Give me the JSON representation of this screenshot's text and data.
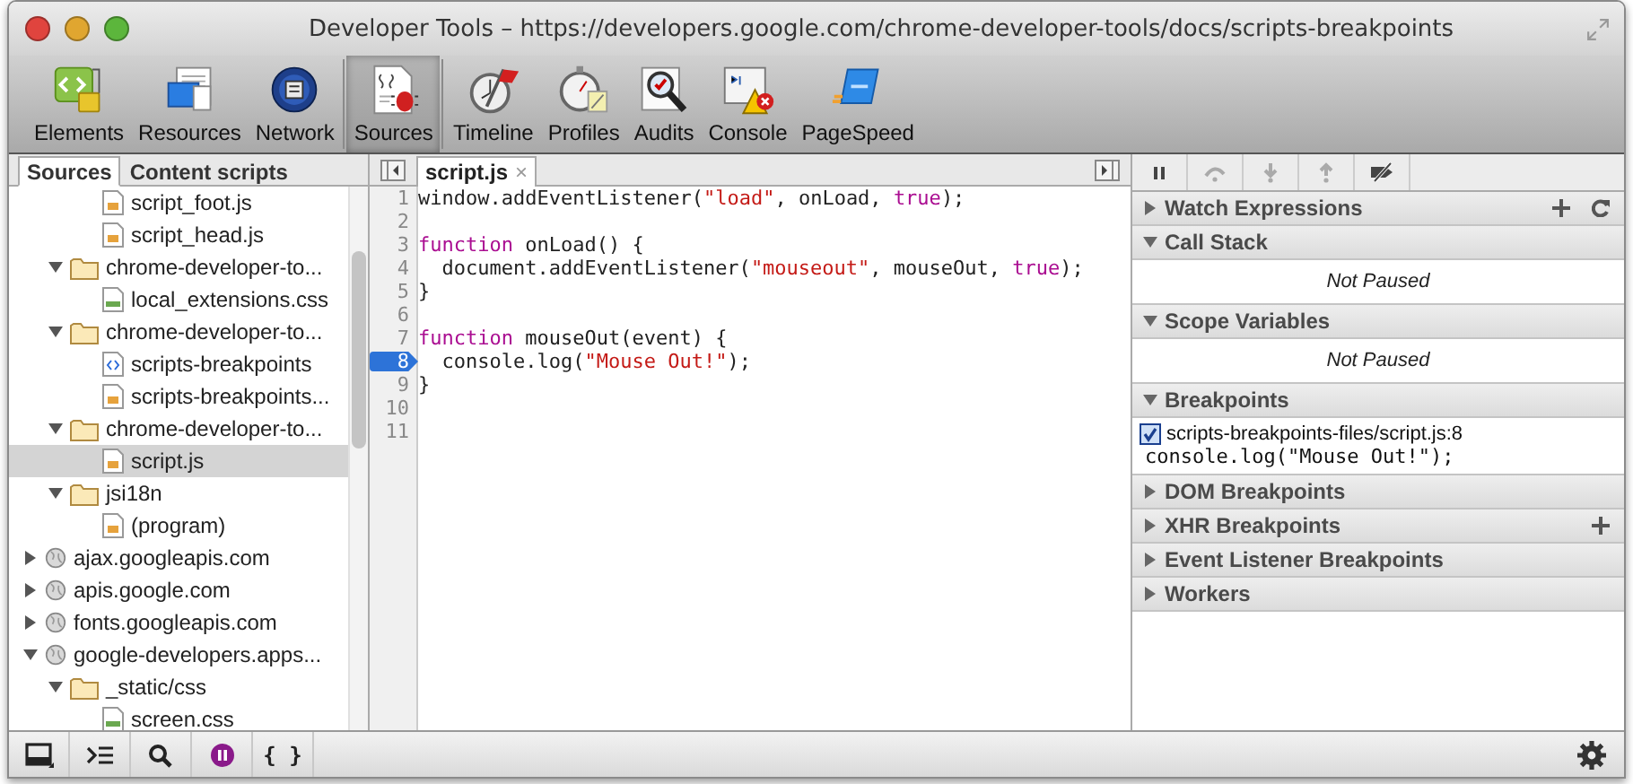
{
  "window": {
    "title": "Developer Tools – https://developers.google.com/chrome-developer-tools/docs/scripts-breakpoints"
  },
  "toolbar": [
    {
      "kind": "elements",
      "label": "Elements",
      "selected": false,
      "separator_before": false
    },
    {
      "kind": "resources",
      "label": "Resources",
      "selected": false,
      "separator_before": false
    },
    {
      "kind": "network",
      "label": "Network",
      "selected": false,
      "separator_before": false
    },
    {
      "kind": "sources",
      "label": "Sources",
      "selected": true,
      "separator_before": true
    },
    {
      "kind": "timeline",
      "label": "Timeline",
      "selected": false,
      "separator_before": true
    },
    {
      "kind": "profiles",
      "label": "Profiles",
      "selected": false,
      "separator_before": false
    },
    {
      "kind": "audits",
      "label": "Audits",
      "selected": false,
      "separator_before": false
    },
    {
      "kind": "console",
      "label": "Console",
      "selected": false,
      "separator_before": false
    },
    {
      "kind": "pagespeed",
      "label": "PageSpeed",
      "selected": false,
      "separator_before": false
    }
  ],
  "navigator": {
    "tabs": [
      {
        "label": "Sources",
        "selected": true
      },
      {
        "label": "Content scripts",
        "selected": false
      }
    ],
    "tree": [
      {
        "children": [
          {
            "children": [
              {
                "kind": "script",
                "label": "script_foot.js",
                "selected": false
              },
              {
                "kind": "script",
                "label": "script_head.js",
                "selected": false
              }
            ]
          },
          {
            "kind": "folder",
            "label": "chrome-developer-to...",
            "expanded": true,
            "children": [
              {
                "kind": "stylesheet",
                "label": "local_extensions.css",
                "selected": false
              }
            ]
          },
          {
            "kind": "folder",
            "label": "chrome-developer-to...",
            "expanded": true,
            "children": [
              {
                "kind": "document",
                "label": "scripts-breakpoints",
                "selected": false
              },
              {
                "kind": "script",
                "label": "scripts-breakpoints...",
                "selected": false
              }
            ]
          },
          {
            "kind": "folder",
            "label": "chrome-developer-to...",
            "expanded": true,
            "children": [
              {
                "kind": "script",
                "label": "script.js",
                "selected": true
              }
            ]
          },
          {
            "kind": "folder",
            "label": "jsi18n",
            "expanded": true,
            "children": [
              {
                "kind": "script",
                "label": "(program)",
                "selected": false
              }
            ]
          }
        ]
      },
      {
        "kind": "domain",
        "label": "ajax.googleapis.com",
        "expanded": false
      },
      {
        "kind": "domain",
        "label": "apis.google.com",
        "expanded": false
      },
      {
        "kind": "domain",
        "label": "fonts.googleapis.com",
        "expanded": false
      },
      {
        "kind": "domain",
        "label": "google-developers.apps...",
        "expanded": true,
        "children": [
          {
            "kind": "folder",
            "label": "_static/css",
            "expanded": true,
            "children": [
              {
                "kind": "stylesheet",
                "label": "screen.css",
                "selected": false
              }
            ]
          }
        ]
      }
    ]
  },
  "editor": {
    "tab": {
      "label": "script.js",
      "close": "×"
    },
    "lines": [
      {
        "number": "1",
        "breakpoint": false,
        "tokens": [
          {
            "kind": "plain",
            "text": "window.addEventListener("
          },
          {
            "kind": "string",
            "text": "\"load\""
          },
          {
            "kind": "plain",
            "text": ", onLoad, "
          },
          {
            "kind": "keyword",
            "text": "true"
          },
          {
            "kind": "plain",
            "text": ");"
          }
        ]
      },
      {
        "number": "2",
        "breakpoint": false
      },
      {
        "number": "3",
        "breakpoint": false,
        "tokens": [
          {
            "kind": "keyword",
            "text": "function"
          },
          {
            "kind": "plain",
            "text": " onLoad() {"
          }
        ]
      },
      {
        "number": "4",
        "breakpoint": false,
        "tokens": [
          {
            "kind": "plain",
            "text": "  document.addEventListener("
          },
          {
            "kind": "string",
            "text": "\"mouseout\""
          },
          {
            "kind": "plain",
            "text": ", mouseOut, "
          },
          {
            "kind": "keyword",
            "text": "true"
          },
          {
            "kind": "plain",
            "text": ");"
          }
        ]
      },
      {
        "number": "5",
        "breakpoint": false,
        "tokens": [
          {
            "kind": "plain",
            "text": "}"
          }
        ]
      },
      {
        "number": "6",
        "breakpoint": false
      },
      {
        "number": "7",
        "breakpoint": false,
        "tokens": [
          {
            "kind": "keyword",
            "text": "function"
          },
          {
            "kind": "plain",
            "text": " mouseOut(event) {"
          }
        ]
      },
      {
        "number": "8",
        "breakpoint": true,
        "tokens": [
          {
            "kind": "plain",
            "text": "  console.log("
          },
          {
            "kind": "string",
            "text": "\"Mouse Out!\""
          },
          {
            "kind": "plain",
            "text": ");"
          }
        ]
      },
      {
        "number": "9",
        "breakpoint": false,
        "tokens": [
          {
            "kind": "plain",
            "text": "}"
          }
        ]
      },
      {
        "number": "10",
        "breakpoint": false
      },
      {
        "number": "11",
        "breakpoint": false
      }
    ]
  },
  "debugger": {
    "buttons": [
      {
        "kind": "pause",
        "disabled": false
      },
      {
        "kind": "step-over",
        "disabled": true
      },
      {
        "kind": "step-into",
        "disabled": true
      },
      {
        "kind": "step-out",
        "disabled": true
      },
      {
        "kind": "deactivate",
        "disabled": false
      }
    ],
    "sections": [
      {
        "title": "Watch Expressions",
        "expanded": false,
        "actions": [
          {
            "kind": "add"
          },
          {
            "kind": "refresh"
          }
        ]
      },
      {
        "title": "Call Stack",
        "expanded": true,
        "message": "Not Paused"
      },
      {
        "title": "Scope Variables",
        "expanded": true,
        "message": "Not Paused"
      },
      {
        "title": "Breakpoints",
        "expanded": true,
        "breakpoints": [
          {
            "location": "scripts-breakpoints-files/script.js:8",
            "code": "console.log(\"Mouse Out!\");",
            "checked": true
          }
        ]
      },
      {
        "title": "DOM Breakpoints",
        "expanded": false
      },
      {
        "title": "XHR Breakpoints",
        "expanded": false,
        "actions": [
          {
            "kind": "add"
          }
        ]
      },
      {
        "title": "Event Listener Breakpoints",
        "expanded": false
      },
      {
        "title": "Workers",
        "expanded": false
      }
    ]
  },
  "status_bar": [
    {
      "kind": "dock"
    },
    {
      "kind": "console"
    },
    {
      "kind": "search"
    },
    {
      "kind": "pause-exceptions",
      "active": true
    },
    {
      "kind": "pretty-print",
      "label": "{ }"
    }
  ]
}
